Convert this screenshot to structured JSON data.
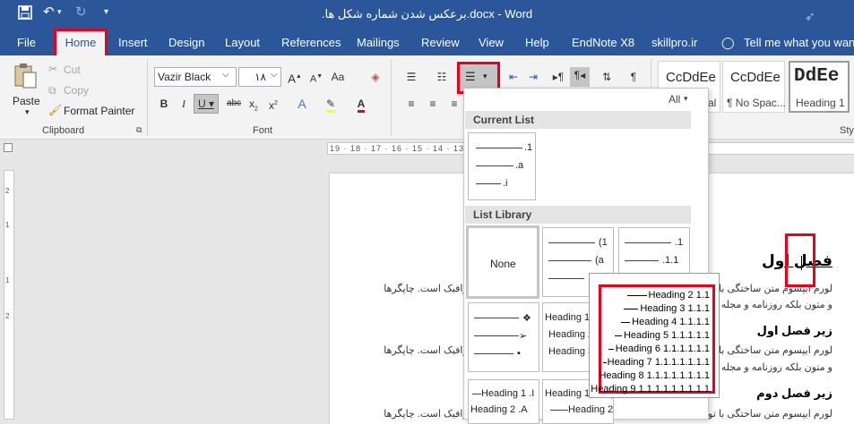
{
  "titlebar": {
    "title": ".برعکس شدن شماره شکل ها.docx  -  Word",
    "save_icon": "save-icon",
    "undo_icon": "undo-icon",
    "redo_icon": "redo-icon",
    "customize_icon": "customize-qat-icon"
  },
  "tabs": [
    {
      "label": "File"
    },
    {
      "label": "Home"
    },
    {
      "label": "Insert"
    },
    {
      "label": "Design"
    },
    {
      "label": "Layout"
    },
    {
      "label": "References"
    },
    {
      "label": "Mailings"
    },
    {
      "label": "Review"
    },
    {
      "label": "View"
    },
    {
      "label": "Help"
    },
    {
      "label": "EndNote X8"
    },
    {
      "label": "skillpro.ir"
    },
    {
      "label": "Tell me what you want t"
    }
  ],
  "clipboard": {
    "paste": "Paste",
    "cut": "Cut",
    "copy": "Copy",
    "format_painter": "Format Painter",
    "group_label": "Clipboard"
  },
  "font": {
    "name": "Vazir Black",
    "size": "۱۸",
    "group_label": "Font"
  },
  "styles": {
    "items": [
      {
        "sample": "CcDdEe",
        "name": "al"
      },
      {
        "sample": "CcDdEe",
        "name": "¶ No Spac..."
      },
      {
        "sample": "DdEe",
        "name": "Heading 1"
      }
    ],
    "group_label": "Sty"
  },
  "ruler": {
    "text": "19 · 18 · 17 · 16 · 15 · 14 · 13 · 12 · 11 · 10 · 9 · 8 · 7 · 6 · 5 · 4 · 3 · 2 · 1 · · · 1 · 2"
  },
  "vruler": {
    "marks": [
      "2",
      "1",
      "1",
      "2"
    ]
  },
  "dropdown": {
    "filter": "All",
    "current_list_title": "Current List",
    "current_list": [
      ".1",
      ".a",
      ".i"
    ],
    "library_title": "List Library",
    "none_label": "None",
    "tile2": [
      "(1",
      "(a",
      "i"
    ],
    "tile3": [
      ".1",
      ".1.1",
      ""
    ],
    "tile4_labels": [
      "Heading 1 .Arti",
      "Heading 2 Section",
      "Heading 3"
    ],
    "tile5_labels": [
      "Heading 1 .I",
      "Heading 2 .A"
    ],
    "tile6_labels": [
      "Heading 1 Chap",
      "Heading 2"
    ]
  },
  "popup": {
    "rows": [
      "Heading 2 1.1",
      "Heading 3 1.1.1",
      "Heading 4 1.1.1.1",
      "Heading 5 1.1.1.1.1",
      "Heading 6 1.1.1.1.1.1",
      "Heading 7 1.1.1.1.1.1.1",
      "Heading 8 1.1.1.1.1.1.1.1",
      "Heading 9 1.1.1.1.1.1.1.1.1"
    ]
  },
  "document": {
    "heading1": "فصل اول",
    "body1a": "لورم ایپسوم متن ساختگی با تولید سادگی نامفهوم از صنعت چاپ و با استفاده از طراحان گرافیک است. چاپگرها",
    "body1b": "و متون بلکه روزنامه و مجله در ستون و سطرآنچنان که لازم است",
    "sub1": "زیر فصل اول",
    "body2a": "لورم ایپسوم متن ساختگی با تولید سادگی نامفهوم از صنعت چاپ و با استفاده از طراحان گرافیک است. چاپگرها",
    "body2b": "و متون بلکه روزنامه و مجله در ستون و سطرآنچنان که لازم است",
    "sub2": "زیر فصل دوم",
    "body3a": "لورم ایپسوم متن ساختگی با تولید سادگی نامفهوم از صنعت چاپ و با استفاده از طراحان گرافیک است. چاپگرها"
  },
  "colors": {
    "accent": "#2b579a",
    "highlight": "#e8001c"
  }
}
